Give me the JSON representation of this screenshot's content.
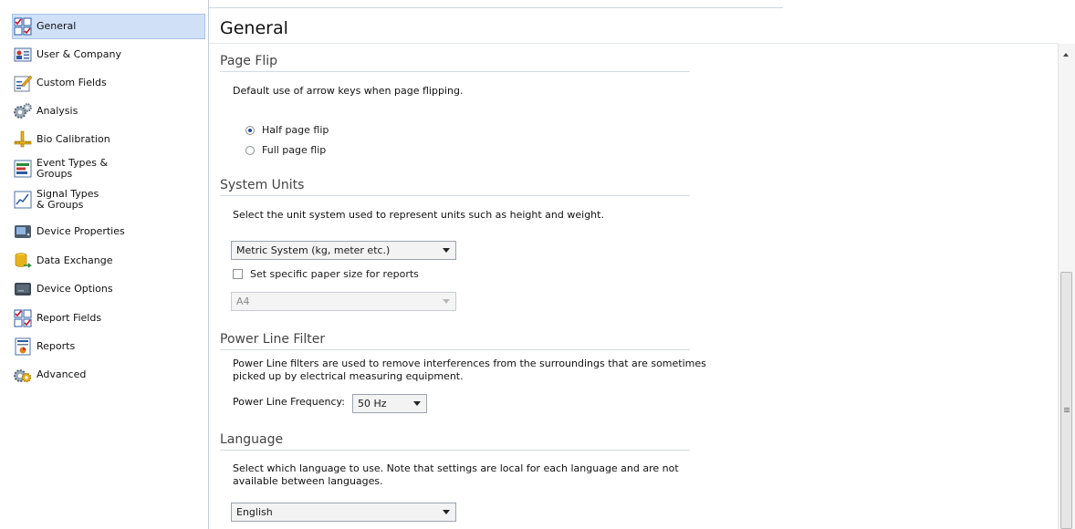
{
  "sidebar": {
    "items": [
      {
        "label": "General",
        "icon": "checklist-icon",
        "active": true
      },
      {
        "label": "User & Company",
        "icon": "user-card-icon"
      },
      {
        "label": "Custom Fields",
        "icon": "custom-fields-icon"
      },
      {
        "label": "Analysis",
        "icon": "gears-icon"
      },
      {
        "label": "Bio Calibration",
        "icon": "ruler-calibration-icon"
      },
      {
        "label": "Event Types & Groups",
        "icon": "event-types-icon"
      },
      {
        "label": "Signal Types & Groups",
        "icon": "signal-chart-icon"
      },
      {
        "label": "Device Properties",
        "icon": "device-icon"
      },
      {
        "label": "Data Exchange",
        "icon": "database-exchange-icon"
      },
      {
        "label": "Device Options",
        "icon": "device-options-icon"
      },
      {
        "label": "Report Fields",
        "icon": "report-fields-icon"
      },
      {
        "label": "Reports",
        "icon": "reports-icon"
      },
      {
        "label": "Advanced",
        "icon": "advanced-gears-icon"
      }
    ]
  },
  "main": {
    "title": "General",
    "page_flip": {
      "heading": "Page Flip",
      "description": "Default use of arrow keys when page flipping.",
      "options": [
        "Half page flip",
        "Full page flip"
      ],
      "selected": "Half page flip"
    },
    "system_units": {
      "heading": "System Units",
      "description": "Select the unit system used to represent units such as height and weight.",
      "unit_value": "Metric System (kg, meter etc.)",
      "paper_checkbox_label": "Set specific paper size for reports",
      "paper_checked": false,
      "paper_value": "A4"
    },
    "power_line": {
      "heading": "Power Line Filter",
      "description_line1": "Power Line filters are used to remove interferences from the surroundings that are sometimes",
      "description_line2": "picked up by electrical measuring equipment.",
      "frequency_label": "Power Line Frequency:",
      "frequency_value": "50 Hz"
    },
    "language": {
      "heading": "Language",
      "description_line1": "Select which language to use. Note that settings are local for each language and are not",
      "description_line2": "available between languages.",
      "value": "English"
    }
  }
}
